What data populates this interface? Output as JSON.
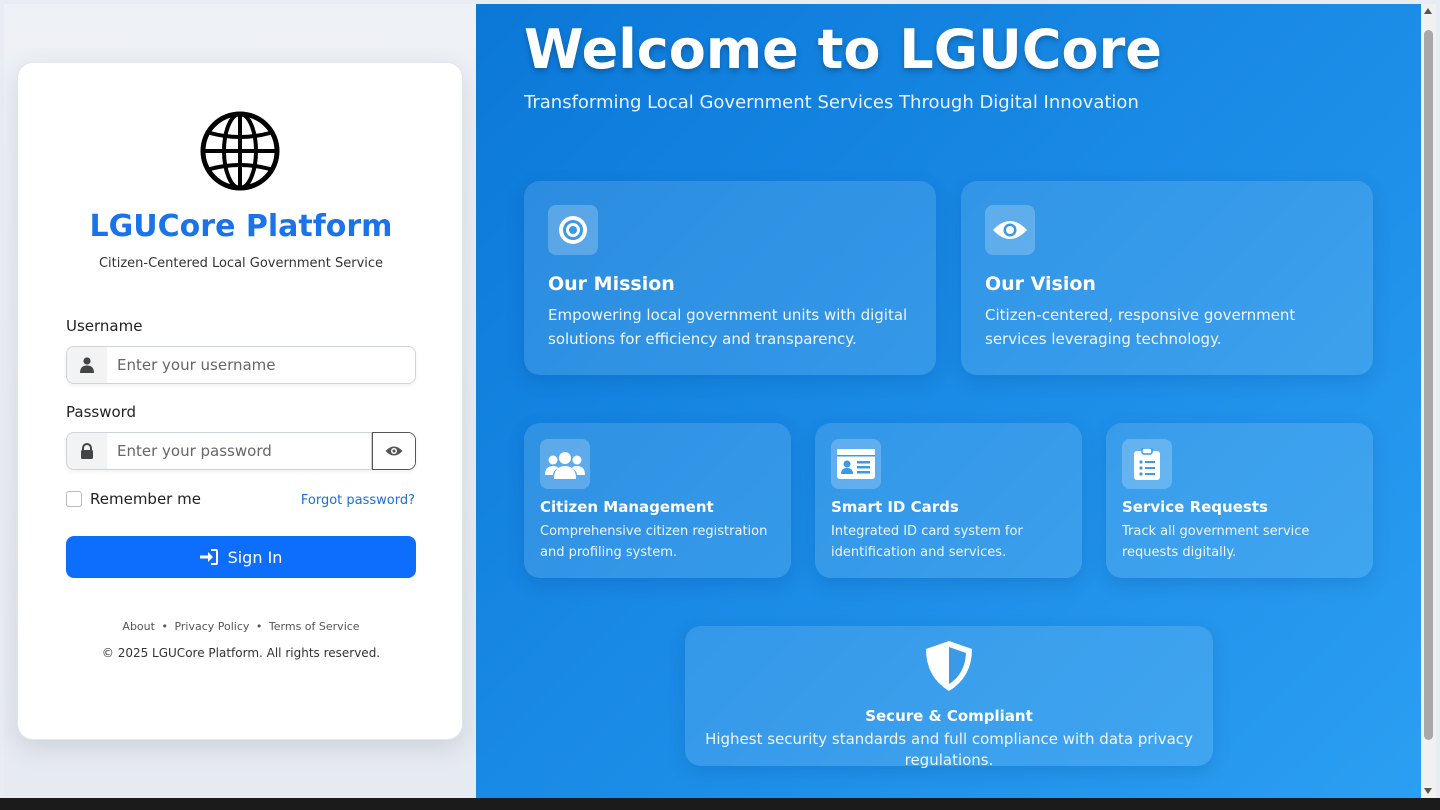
{
  "login": {
    "brand_title": "LGUCore Platform",
    "brand_subtitle": "Citizen-Centered Local Government Service",
    "username_label": "Username",
    "username_placeholder": "Enter your username",
    "password_label": "Password",
    "password_placeholder": "Enter your password",
    "remember_label": "Remember me",
    "forgot_label": "Forgot password?",
    "signin_label": "Sign In",
    "footer": {
      "about": "About",
      "privacy": "Privacy Policy",
      "terms": "Terms of Service",
      "separator": "•",
      "copyright": "© 2025 LGUCore Platform. All rights reserved."
    }
  },
  "hero": {
    "title": "Welcome to LGUCore",
    "subtitle": "Transforming Local Government Services Through Digital Innovation"
  },
  "cards": {
    "mission": {
      "title": "Our Mission",
      "text": "Empowering local government units with digital solutions for efficiency and transparency."
    },
    "vision": {
      "title": "Our Vision",
      "text": "Citizen-centered, responsive government services leveraging technology."
    },
    "citizen": {
      "title": "Citizen Management",
      "text": "Comprehensive citizen registration and profiling system."
    },
    "smartid": {
      "title": "Smart ID Cards",
      "text": "Integrated ID card system for identification and services."
    },
    "service": {
      "title": "Service Requests",
      "text": "Track all government service requests digitally."
    },
    "secure": {
      "title": "Secure & Compliant",
      "text": "Highest security standards and full compliance with data privacy regulations."
    }
  },
  "colors": {
    "brand": "#1a73e8",
    "primary_button": "#0d6efd",
    "hero_gradient_start": "#0b78d8",
    "hero_gradient_end": "#2b9ff2"
  },
  "icons": {
    "logo": "globe-icon",
    "username": "user-icon",
    "password": "lock-icon",
    "toggle": "eye-icon",
    "signin": "sign-in-icon",
    "mission": "target-icon",
    "vision": "eye-icon",
    "citizen": "users-icon",
    "smartid": "id-card-icon",
    "service": "clipboard-list-icon",
    "secure": "shield-icon"
  }
}
